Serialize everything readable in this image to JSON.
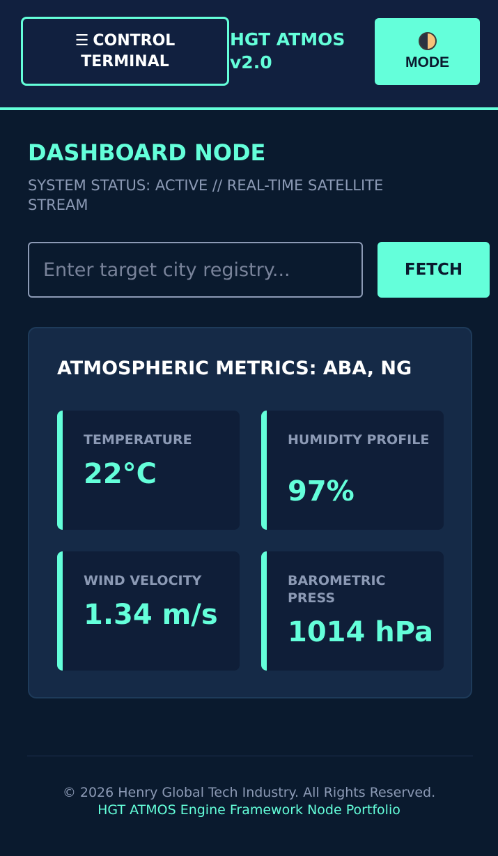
{
  "header": {
    "menu_icon": "☰",
    "menu_label": "CONTROL TERMINAL",
    "brand": "HGT ATMOS v2.0",
    "mode_icon": "half-moon-icon",
    "mode_label": "MODE"
  },
  "dashboard": {
    "title": "DASHBOARD NODE",
    "subtitle": "SYSTEM STATUS: ACTIVE // REAL-TIME SATELLITE STREAM"
  },
  "search": {
    "placeholder": "Enter target city registry...",
    "value": "",
    "button_label": "FETCH"
  },
  "metrics": {
    "title": "ATMOSPHERIC METRICS: ABA, NG",
    "cards": [
      {
        "label": "TEMPERATURE",
        "value": "22°C"
      },
      {
        "label": "HUMIDITY PROFILE",
        "value": "97%"
      },
      {
        "label": "WIND VELOCITY",
        "value": "1.34 m/s"
      },
      {
        "label": "BAROMETRIC PRESS",
        "value": "1014 hPa"
      }
    ]
  },
  "footer": {
    "copyright": "© 2026 Henry Global Tech Industry. All Rights Reserved.",
    "link": "HGT ATMOS Engine Framework Node Portfolio"
  },
  "colors": {
    "accent": "#64ffda",
    "background": "#0a1a2e",
    "header_bg": "#11203f",
    "panel_bg": "#152a47",
    "card_bg": "#0f1e38",
    "muted_text": "#8c9ab5"
  }
}
